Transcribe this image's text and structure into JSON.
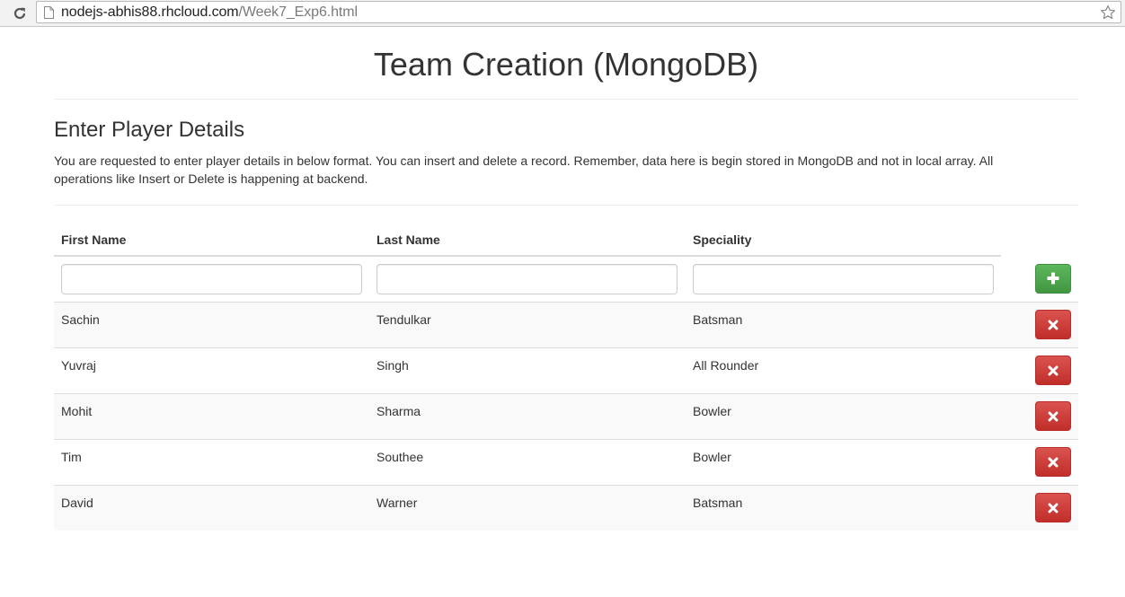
{
  "browser": {
    "url_host": "nodejs-abhis88.rhcloud.com",
    "url_path": "/Week7_Exp6.html",
    "reload_icon": "reload-icon",
    "page_icon": "page-icon",
    "bookmark_icon": "star-icon"
  },
  "page": {
    "title": "Team Creation (MongoDB)",
    "section_title": "Enter Player Details",
    "description": "You are requested to enter player details in below format. You can insert and delete a record. Remember, data here is begin stored in MongoDB and not in local array. All operations like Insert or Delete is happening at backend."
  },
  "table": {
    "headers": [
      "First Name",
      "Last Name",
      "Speciality"
    ],
    "inputs": {
      "first_name": "",
      "last_name": "",
      "speciality": ""
    },
    "add_icon": "plus-icon",
    "delete_icon": "times-icon",
    "rows": [
      [
        "Sachin",
        "Tendulkar",
        "Batsman"
      ],
      [
        "Yuvraj",
        "Singh",
        "All Rounder"
      ],
      [
        "Mohit",
        "Sharma",
        "Bowler"
      ],
      [
        "Tim",
        "Southee",
        "Bowler"
      ],
      [
        "David",
        "Warner",
        "Batsman"
      ]
    ]
  },
  "colors": {
    "add_button": "#5cb85c",
    "delete_button": "#d9534f",
    "stripe": "#f9f9f9",
    "border": "#dddddd",
    "text": "#333333"
  }
}
